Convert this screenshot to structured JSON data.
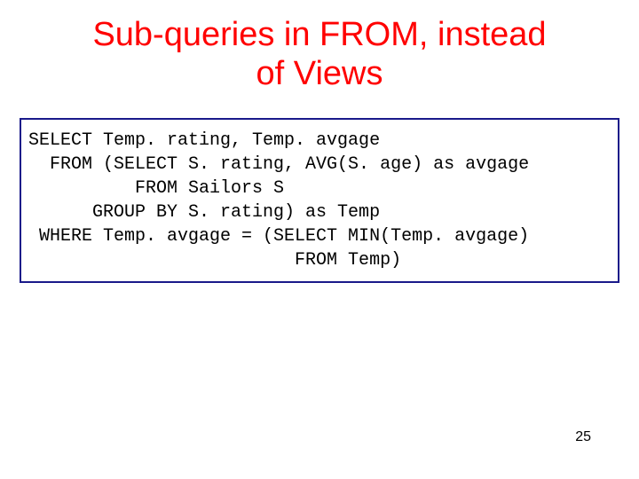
{
  "title_line1": "Sub-queries in FROM, instead",
  "title_line2": "of Views",
  "code": {
    "l1": "SELECT Temp. rating, Temp. avgage",
    "l2": "  FROM (SELECT S. rating, AVG(S. age) as avgage",
    "l3": "          FROM Sailors S",
    "l4": "      GROUP BY S. rating) as Temp",
    "l5": " WHERE Temp. avgage = (SELECT MIN(Temp. avgage)",
    "l6": "                         FROM Temp)"
  },
  "page_number": "25"
}
